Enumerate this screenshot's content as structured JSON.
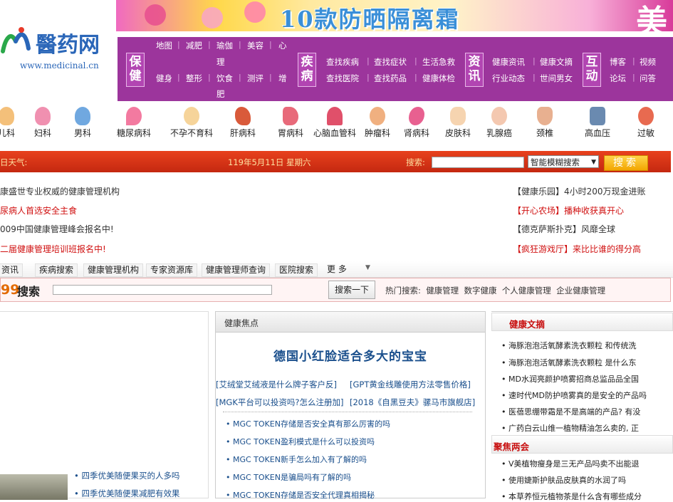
{
  "banner": {
    "headline": "10款防晒隔离霜",
    "corner": "美"
  },
  "logo": {
    "name": "醫药网",
    "url": "www.medicinal.cn"
  },
  "nav": {
    "groups": [
      {
        "label": "保健",
        "links": [
          "地图",
          "减肥",
          "瑜伽",
          "美容",
          "心",
          "理",
          "健身",
          "整形",
          "饮食",
          "测评",
          "增",
          "肥"
        ]
      },
      {
        "label": "疾病",
        "links": [
          "查找疾病",
          "查找症状",
          "生活急救",
          "查找医院",
          "查找药品",
          "健康体检"
        ]
      },
      {
        "label": "资讯",
        "links": [
          "健康资讯",
          "健康文摘",
          "行业动态",
          "世间男女"
        ]
      },
      {
        "label": "互动",
        "links": [
          "博客",
          "视频",
          "论坛",
          "问答"
        ]
      }
    ]
  },
  "departments": [
    "儿科",
    "妇科",
    "男科",
    "糖尿病科",
    "不孕不育科",
    "肝病科",
    "胃病科",
    "心脑血管科",
    "肿瘤科",
    "肾病科",
    "皮肤科",
    "乳腺癌",
    "颈椎",
    "高血压",
    "过敏"
  ],
  "redbar": {
    "weather": "日天气:",
    "date": "119年5月11日 星期六",
    "search_label": "搜索:",
    "select_value": "智能模糊搜索",
    "search_button": "搜索"
  },
  "news_left": [
    {
      "text": "康盛世专业权威的健康管理机构",
      "red": false
    },
    {
      "text": "尿病人首选安全主食",
      "red": true
    },
    {
      "text": "009中国健康管理峰会报名中!",
      "red": false
    },
    {
      "text": "二届健康管理培训班报名中!",
      "red": true
    }
  ],
  "news_right": [
    {
      "text": "【健康乐园】4小时200万现金进账",
      "red": false
    },
    {
      "text": "【开心农场】播种收获真开心",
      "red": true
    },
    {
      "text": "【德克萨斯扑克】风靡全球",
      "red": false
    },
    {
      "text": "【疯狂游戏厅】来比比谁的得分高",
      "red": true
    }
  ],
  "tabs": [
    "资讯",
    "疾病搜索",
    "健康管理机构",
    "专家资源库",
    "健康管理师查询",
    "医院搜索",
    "更 多"
  ],
  "search99": {
    "num": "99",
    "label": "搜索",
    "button": "搜索一下",
    "hot_label": "热门搜索:",
    "hot": [
      "健康管理",
      "数字健康",
      "个人健康管理",
      "企业健康管理"
    ]
  },
  "mid": {
    "header": "健康焦点",
    "headline": "德国小红脸适合多大的宝宝",
    "links": [
      "[艾绒堂艾绒液是什么牌子客户反]",
      "[GPT黄金线雕使用方法零售价格]",
      "[MGK平台可以投资吗?怎么注册加]",
      "[2018《自黑豆夫》骡马市旗舰店]"
    ],
    "bullets": [
      "• MGC TOKEN存储是否安全真有那么厉害的吗",
      "• MGC TOKEN盈利模式是什么可以投资吗",
      "• MGC TOKEN新手怎么加入有了解的吗",
      "• MGC TOKEN是骗局吗有了解的吗",
      "• MGC TOKEN存储是否安全代理真相揭秘"
    ]
  },
  "left": {
    "items": [
      "• 四季优美随便果买的人多吗",
      "• 四季优美随便果减肥有效果"
    ]
  },
  "right": {
    "head1": "健康文摘",
    "items1": [
      "• 海豚泡泡活氧酵素洗衣颗粒 和传统洗",
      "• 海豚泡泡活氧酵素洗衣颗粒 是什么东",
      "• MD水润亮颜护喷雾招商总监品品全国",
      "• 速时代MD防护喷雾真的是安全的产品吗",
      "• 医蓓思绷带霜是不是高端的产品? 有没",
      "• 广药白云山维一植物精油怎么卖的, 正"
    ],
    "head2": "聚焦两会",
    "items2": [
      "• V美植物瘦身是三无产品吗卖不出能退",
      "• 使用婕斯护肤品皮肤真的水润了吗",
      "• 本草养恒元植物茶是什么含有哪些成分"
    ]
  }
}
